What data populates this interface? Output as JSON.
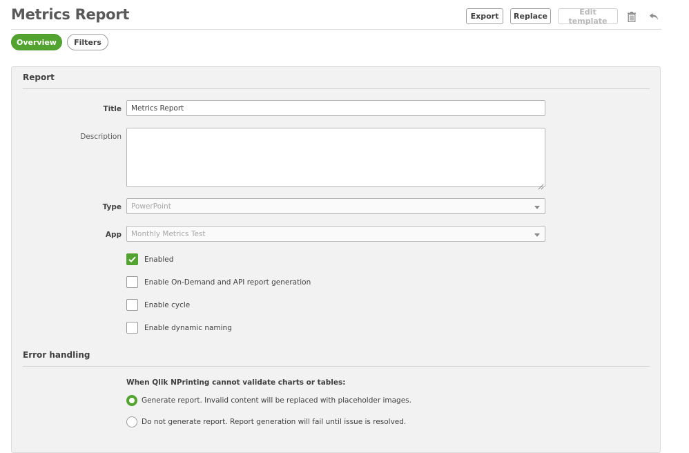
{
  "header": {
    "title": "Metrics Report",
    "export_label": "Export",
    "replace_label": "Replace",
    "edit_template_label": "Edit template"
  },
  "tabs": [
    {
      "label": "Overview",
      "active": true
    },
    {
      "label": "Filters",
      "active": false
    }
  ],
  "report": {
    "section_title": "Report",
    "title_label": "Title",
    "title_value": "Metrics Report",
    "description_label": "Description",
    "description_value": "",
    "type_label": "Type",
    "type_value": "PowerPoint",
    "app_label": "App",
    "app_value": "Monthly Metrics Test",
    "checkboxes": [
      {
        "label": "Enabled",
        "checked": true
      },
      {
        "label": "Enable On-Demand and API report generation",
        "checked": false
      },
      {
        "label": "Enable cycle",
        "checked": false
      },
      {
        "label": "Enable dynamic naming",
        "checked": false
      }
    ]
  },
  "error_handling": {
    "section_title": "Error handling",
    "prompt": "When Qlik NPrinting cannot validate charts or tables:",
    "options": [
      {
        "label": "Generate report. Invalid content will be replaced with placeholder images.",
        "selected": true
      },
      {
        "label": "Do not generate report. Report generation will fail until issue is resolved.",
        "selected": false
      }
    ]
  },
  "colors": {
    "accent": "#52a32f",
    "panel_bg": "#f2f2f2"
  },
  "icons": {
    "delete": "trash-icon",
    "back": "undo-arrow-icon"
  }
}
